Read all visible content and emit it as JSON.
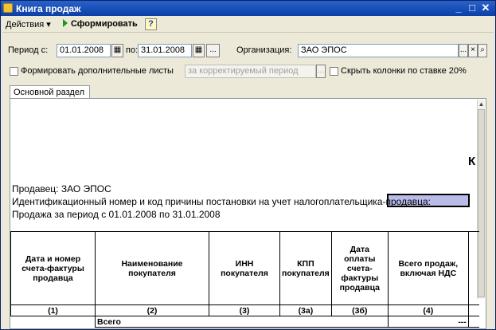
{
  "window": {
    "title": "Книга продаж"
  },
  "toolbar": {
    "actions_label": "Действия",
    "generate_label": "Сформировать",
    "help_label": "?"
  },
  "filters": {
    "period_from_label": "Период с:",
    "period_from_value": "01.01.2008",
    "period_to_label": "по:",
    "period_to_value": "31.01.2008",
    "ellipsis_label": "...",
    "org_label": "Организация:",
    "org_value": "ЗАО ЭПОС",
    "extra_sheets_label": "Формировать дополнительные листы",
    "period_type_placeholder": "за корректируемый период",
    "hide_columns_label": "Скрыть колонки по ставке 20%"
  },
  "tabs": [
    {
      "label": "Основной раздел"
    }
  ],
  "report": {
    "title_partial": "К",
    "seller_line": "Продавец:  ЗАО ЭПОС",
    "inn_line": "Идентификационный номер и код причины постановки на учет налогоплательщика-продавца:",
    "period_line": "Продажа за период с 01.01.2008 по 31.01.2008",
    "columns": [
      {
        "header": "Дата и номер счета-фактуры продавца",
        "num": "(1)"
      },
      {
        "header": "Наименование покупателя",
        "num": "(2)"
      },
      {
        "header": "ИНН покупателя",
        "num": "(3)"
      },
      {
        "header": "КПП покупателя",
        "num": "(3а)"
      },
      {
        "header": "Дата оплаты счета-фактуры продавца",
        "num": "(3б)"
      },
      {
        "header": "Всего продаж, включая НДС",
        "num": "(4)"
      }
    ],
    "total_label": "Всего",
    "total_value": "---"
  }
}
